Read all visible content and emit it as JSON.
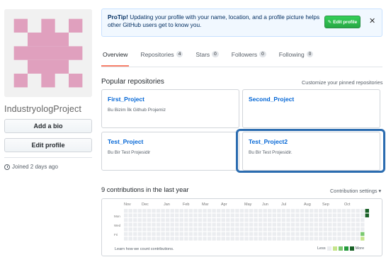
{
  "profile": {
    "username": "IndustryologProject",
    "add_bio_label": "Add a bio",
    "edit_profile_label": "Edit profile",
    "joined_text": "Joined 2 days ago"
  },
  "protip": {
    "bold": "ProTip!",
    "text": " Updating your profile with your name, location, and a profile picture helps other GitHub users get to know you.",
    "button_label": "Edit profile",
    "close_glyph": "✕"
  },
  "tabs": [
    {
      "label": "Overview",
      "count": ""
    },
    {
      "label": "Repositories",
      "count": "4"
    },
    {
      "label": "Stars",
      "count": "0"
    },
    {
      "label": "Followers",
      "count": "0"
    },
    {
      "label": "Following",
      "count": "0"
    }
  ],
  "popular": {
    "title": "Popular repositories",
    "customize_label": "Customize your pinned repositories",
    "repos": [
      {
        "name": "First_Project",
        "desc": "Bu Bizim İlk Github Projemiz"
      },
      {
        "name": "Second_Project",
        "desc": ""
      },
      {
        "name": "Test_Project",
        "desc": "Bu Bir Test Projesidir"
      },
      {
        "name": "Test_Project2",
        "desc": "Bu Bir Test Projesidir."
      }
    ]
  },
  "contributions": {
    "title": "9 contributions in the last year",
    "settings_label": "Contribution settings ▾",
    "months": [
      "Nov",
      "Dec",
      "Jan",
      "Feb",
      "Mar",
      "Apr",
      "May",
      "Jun",
      "Jul",
      "Aug",
      "Sep",
      "Oct"
    ],
    "days": [
      "Mon",
      "Wed",
      "Fri"
    ],
    "learn_label": "Learn how we count contributions.",
    "legend_less": "Less",
    "legend_more": "More"
  },
  "colors": {
    "accent_blue": "#0366d6",
    "green_button": "#28a745",
    "highlight_box": "#2b6cb0",
    "identicon": "#e0a0be",
    "active_tab_underline": "#f9826c"
  }
}
